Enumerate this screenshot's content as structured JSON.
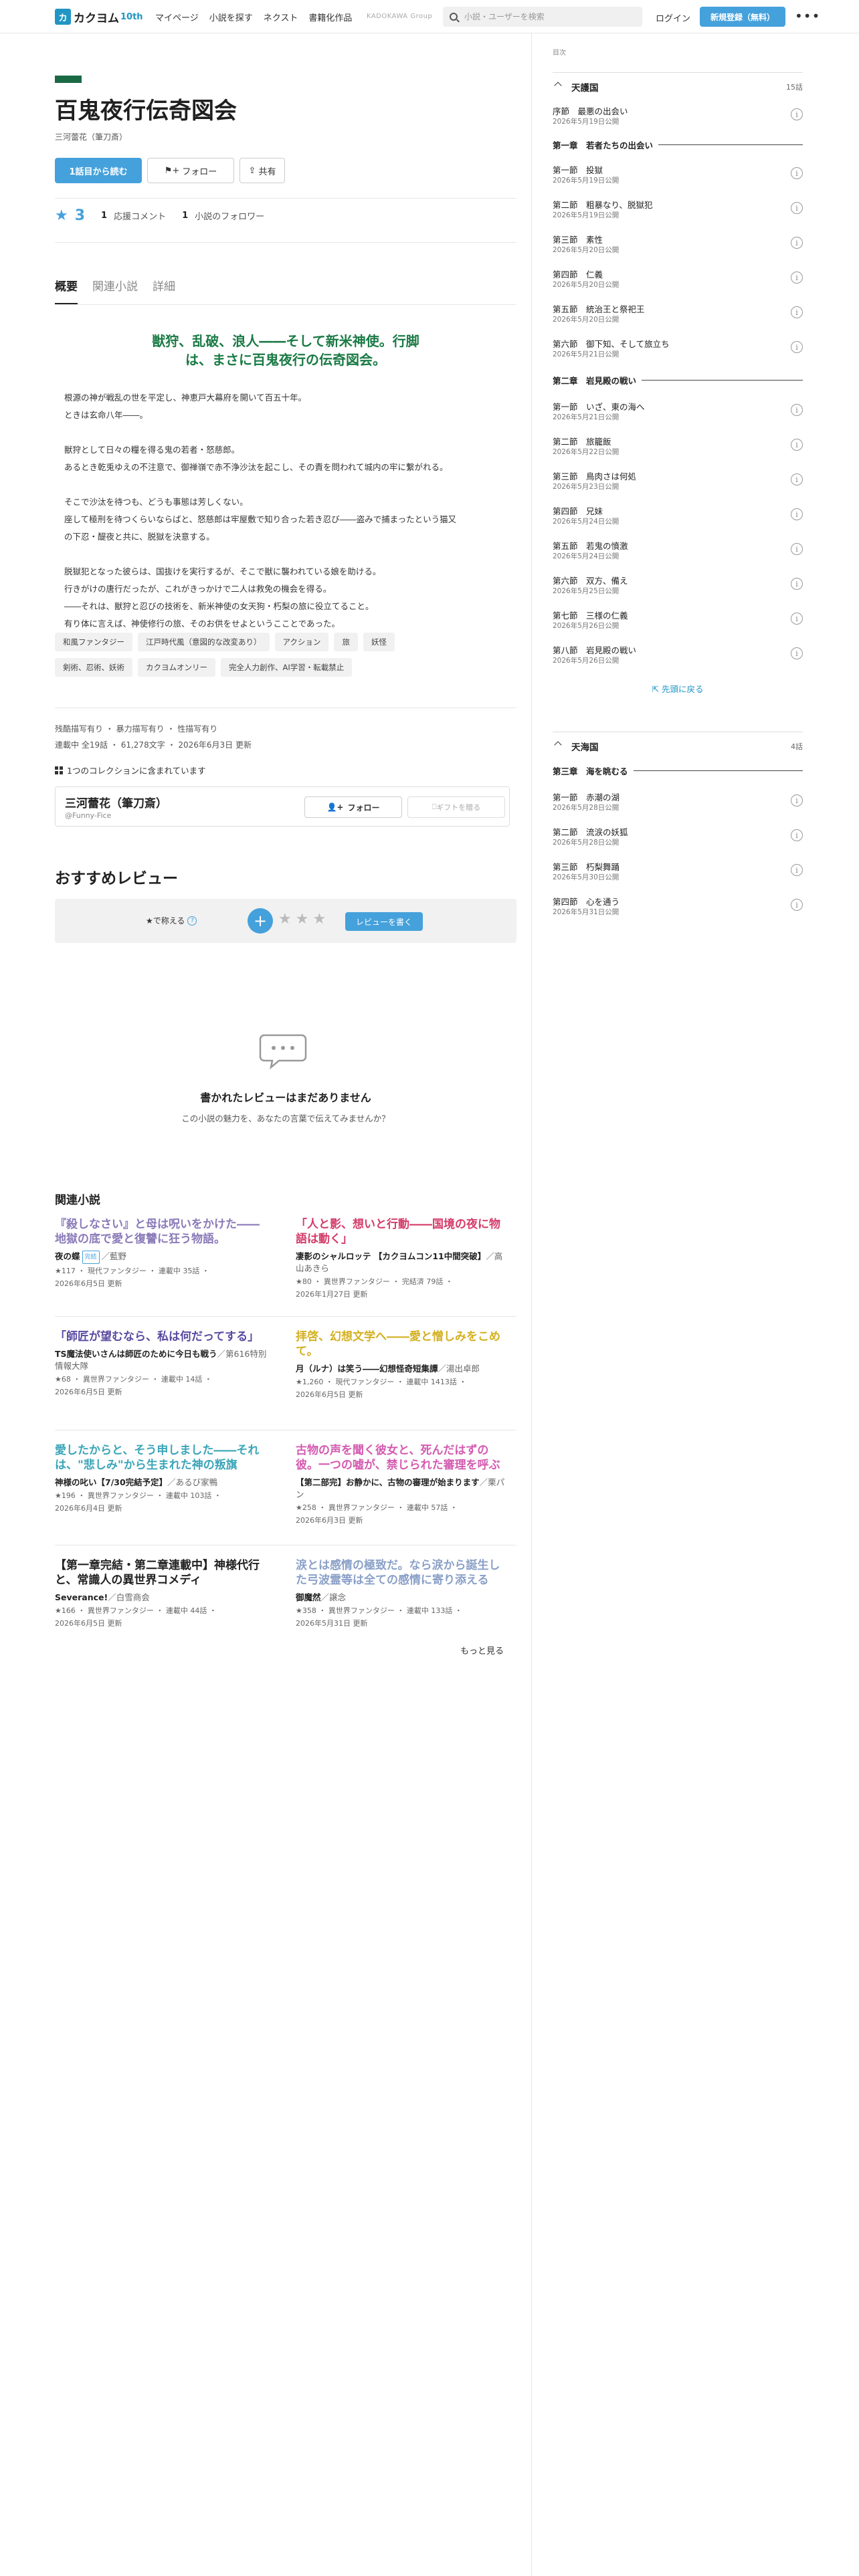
{
  "header": {
    "logo_mark": "カ",
    "logo_text": "カクヨム",
    "logo_badge": "10th",
    "nav": [
      "マイページ",
      "小説を探す",
      "ネクスト",
      "書籍化作品"
    ],
    "group": "KADOKAWA Group",
    "search_placeholder": "小説・ユーザーを検索",
    "login": "ログイン",
    "signup": "新規登録（無料）",
    "more": "•••"
  },
  "work": {
    "title": "百鬼夜行伝奇図会",
    "author": "三河蕾花（筆刀斎）",
    "btn_read": "1話目から読む",
    "btn_follow": "フォロー",
    "btn_share": "共有",
    "stars": "3",
    "comments_count": "1",
    "comments_label": "応援コメント",
    "followers_count": "1",
    "followers_label": "小説のフォロワー"
  },
  "tabs": [
    "概要",
    "関連小説",
    "詳細"
  ],
  "catchphrase": [
    "獣狩、乱破、浪人――そして新米神使。行脚",
    "は、まさに百鬼夜行の伝奇図会。"
  ],
  "intro": [
    "根源の神が戦乱の世を平定し、神恵戸大幕府を開いて百五十年。",
    "ときは玄命八年――。",
    "",
    "獣狩として日々の糧を得る鬼の若者・怒慈郎。",
    "あるとき乾兎ゆえの不注意で、御禅嶺で赤不浄沙汰を起こし、その責を問われて城内の牢に繋がれる。",
    "",
    "そこで沙汰を待つも、どうも事態は芳しくない。",
    "座して極刑を待つくらいならばと、怒慈郎は牢屋敷で知り合った若き忍び――盗みで捕まったという猫又",
    "の下忍・醍夜と共に、脱獄を決意する。",
    "",
    "脱獄犯となった彼らは、国抜けを実行するが、そこで獣に襲われている娘を助ける。",
    "行きがけの唐行だったが、これがきっかけで二人は救免の機会を得る。",
    "――それは、獣狩と忍びの技術を、新米神使の女天狗・朽梨の旅に役立てること。",
    "有り体に言えば、神使修行の旅、そのお供をせよというこことであった。"
  ],
  "tags": [
    "和風ファンタジー",
    "江戸時代風（意図的な改変あり）",
    "アクション",
    "旅",
    "妖怪",
    "剣術、忍術、妖術",
    "カクヨムオンリー",
    "完全人力創作、AI学習・転載禁止"
  ],
  "warnings": "残酷描写有り ・ 暴力描写有り ・ 性描写有り",
  "status": "連載中 全19話 ・ 61,278文字 ・ 2026年6月3日 更新",
  "collection": "1つのコレクションに含まれています",
  "author_card": {
    "name": "三河蕾花（筆刀斎）",
    "handle": "@Funny-Fice",
    "follow": "フォロー",
    "gift": "ギフトを贈る"
  },
  "reviews": {
    "title": "おすすめレビュー",
    "teach": "★で称える",
    "help": "?",
    "plus": "+",
    "stars": "★★★",
    "write": "レビューを書く",
    "empty_title": "書かれたレビューはまだありません",
    "empty_sub": "この小説の魅力を、あなたの言葉で伝えてみませんか？"
  },
  "related": {
    "title": "関連小説",
    "more": "もっと見る",
    "items": [
      {
        "title": "『殺しなさい』と母は呪いをかけた――地獄の底で愛と復讐に狂う物語。",
        "color": "#8a7ab8",
        "name": "夜の蝶",
        "badge": "完結",
        "by": "／藍野",
        "meta1": "★117 ・ 現代ファンタジー ・ 連載中 35話 ・",
        "meta2": "2026年6月5日 更新"
      },
      {
        "title": "「人と影、想いと行動――国境の夜に物語は動く」",
        "color": "#d43c6a",
        "name": "凄影のシャルロッテ 【カクヨムコン11中間突破】",
        "badge": "",
        "by": "／高山あきら",
        "meta1": "★80 ・ 異世界ファンタジー ・ 完結済 79話 ・",
        "meta2": "2026年1月27日 更新"
      },
      {
        "title": "「師匠が望むなら、私は何だってする」",
        "color": "#5a4aa0",
        "name": "TS魔法使いさんは師匠のために今日も戦う",
        "badge": "",
        "by": "／第616特別情報大隊",
        "meta1": "★68 ・ 異世界ファンタジー ・ 連載中 14話 ・",
        "meta2": "2026年6月5日 更新"
      },
      {
        "title": "拝啓、幻想文学へ――愛と憎しみをこめて。",
        "color": "#d4b020",
        "name": "月（ルナ）は笑う――幻想怪奇短集譚",
        "badge": "",
        "by": "／湯出卓郎",
        "meta1": "★1,260 ・ 現代ファンタジー ・ 連載中 1413話 ・",
        "meta2": "2026年6月5日 更新"
      },
      {
        "title": "愛したからと、そう申しました――それは、\"悲しみ\"から生まれた神の叛旗",
        "color": "#3aa5b8",
        "name": "神様の叱い【7/30完結予定】",
        "badge": "",
        "by": "／あるび家鴨",
        "meta1": "★196 ・ 異世界ファンタジー ・ 連載中 103話 ・",
        "meta2": "2026年6月4日 更新"
      },
      {
        "title": "古物の声を聞く彼女と、死んだはずの彼。一つの嘘が、禁じられた審理を呼ぶ",
        "color": "#d45ab0",
        "name": "【第二部完】お静かに、古物の審理が始まります",
        "badge": "",
        "by": "／栗パン",
        "meta1": "★258 ・ 異世界ファンタジー ・ 連載中 57話 ・",
        "meta2": "2026年6月3日 更新"
      },
      {
        "title": "【第一章完結・第二章連載中】神様代行と、常識人の異世界コメディ",
        "color": "#222222",
        "name": "Severance!",
        "badge": "",
        "by": "／白雪商会",
        "meta1": "★166 ・ 異世界ファンタジー ・ 連載中 44話 ・",
        "meta2": "2026年6月5日 更新"
      },
      {
        "title": "涙とは感情の極致だ。なら涙から誕生した弓波霊等は全ての感情に寄り添える",
        "color": "#8aa0c8",
        "name": "御魔然",
        "badge": "",
        "by": "／譲念",
        "meta1": "★358 ・ 異世界ファンタジー ・ 連載中 133話 ・",
        "meta2": "2026年5月31日 更新"
      }
    ]
  },
  "toc": {
    "label": "目次",
    "top_link": "先頭に戻る",
    "sections": [
      {
        "name": "天護国",
        "count": "15話"
      },
      {
        "name": "天海国",
        "count": "4話"
      }
    ],
    "chapters": [
      "第一章　若者たちの出会い",
      "第二章　岩見殿の戦い",
      "第三章　海を眺むる"
    ],
    "episodes": [
      {
        "t": "序節　最悪の出会い",
        "d": "2026年5月19日公開"
      },
      {
        "t": "第一節　投獄",
        "d": "2026年5月19日公開"
      },
      {
        "t": "第二節　粗暴なり、脱獄犯",
        "d": "2026年5月19日公開"
      },
      {
        "t": "第三節　素性",
        "d": "2026年5月20日公開"
      },
      {
        "t": "第四節　仁義",
        "d": "2026年5月20日公開"
      },
      {
        "t": "第五節　統治王と祭祀王",
        "d": "2026年5月20日公開"
      },
      {
        "t": "第六節　御下知、そして旅立ち",
        "d": "2026年5月21日公開"
      },
      {
        "t": "第一節　いざ、東の海へ",
        "d": "2026年5月21日公開"
      },
      {
        "t": "第二節　旅籠飯",
        "d": "2026年5月22日公開"
      },
      {
        "t": "第三節　鳥肉さは何処",
        "d": "2026年5月23日公開"
      },
      {
        "t": "第四節　兄妹",
        "d": "2026年5月24日公開"
      },
      {
        "t": "第五節　若鬼の憤激",
        "d": "2026年5月24日公開"
      },
      {
        "t": "第六節　双方、備え",
        "d": "2026年5月25日公開"
      },
      {
        "t": "第七節　三様の仁義",
        "d": "2026年5月26日公開"
      },
      {
        "t": "第八節　岩見殿の戦い",
        "d": "2026年5月26日公開"
      },
      {
        "t": "第一節　赤潮の湖",
        "d": "2026年5月28日公開"
      },
      {
        "t": "第二節　流涙の妖狐",
        "d": "2026年5月28日公開"
      },
      {
        "t": "第三節　朽梨舞踊",
        "d": "2026年5月30日公開"
      },
      {
        "t": "第四節　心を通う",
        "d": "2026年5月31日公開"
      }
    ]
  }
}
